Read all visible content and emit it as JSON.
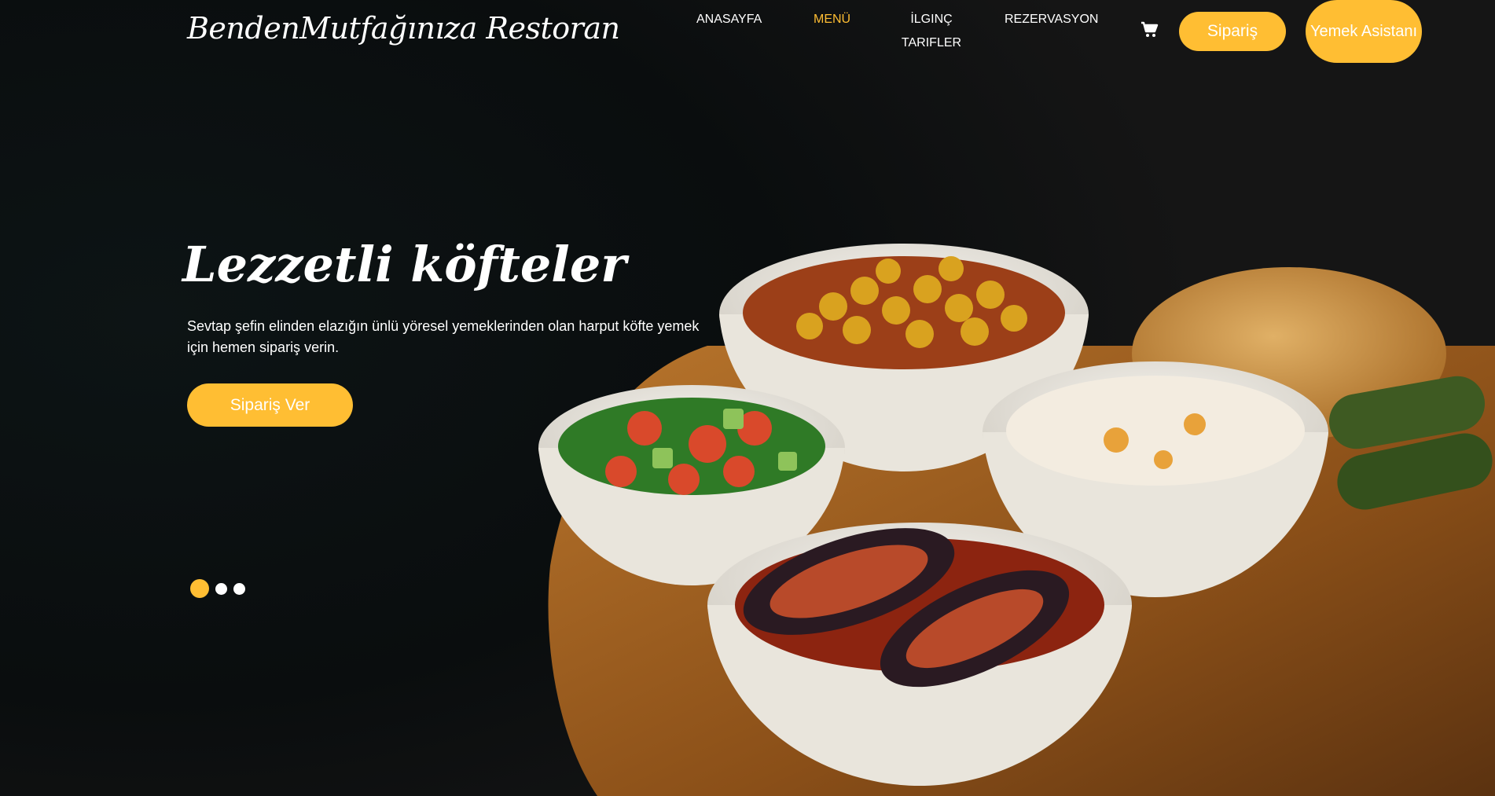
{
  "brand": {
    "name": "BendenMutfağınıza Restoran"
  },
  "nav": {
    "items": [
      {
        "label": "ANASAYFA"
      },
      {
        "label": "MENÜ"
      },
      {
        "label": "İLGINÇ TARIFLER"
      },
      {
        "label": "REZERVASYON"
      }
    ],
    "active_index": 1,
    "cart_icon": "shopping-cart-icon",
    "order_label": "Sipariş",
    "assistant_label": "Yemek Asistanı"
  },
  "hero": {
    "title": "Lezzetli köfteler",
    "text": "Sevtap şefin elinden elazığın ünlü yöresel yemeklerinden olan harput köfte yemek için hemen sipariş verin.",
    "cta_label": "Sipariş Ver",
    "slides_count": 3,
    "active_slide": 1
  },
  "colors": {
    "accent": "#ffbe33",
    "background": "#0c0f10"
  }
}
